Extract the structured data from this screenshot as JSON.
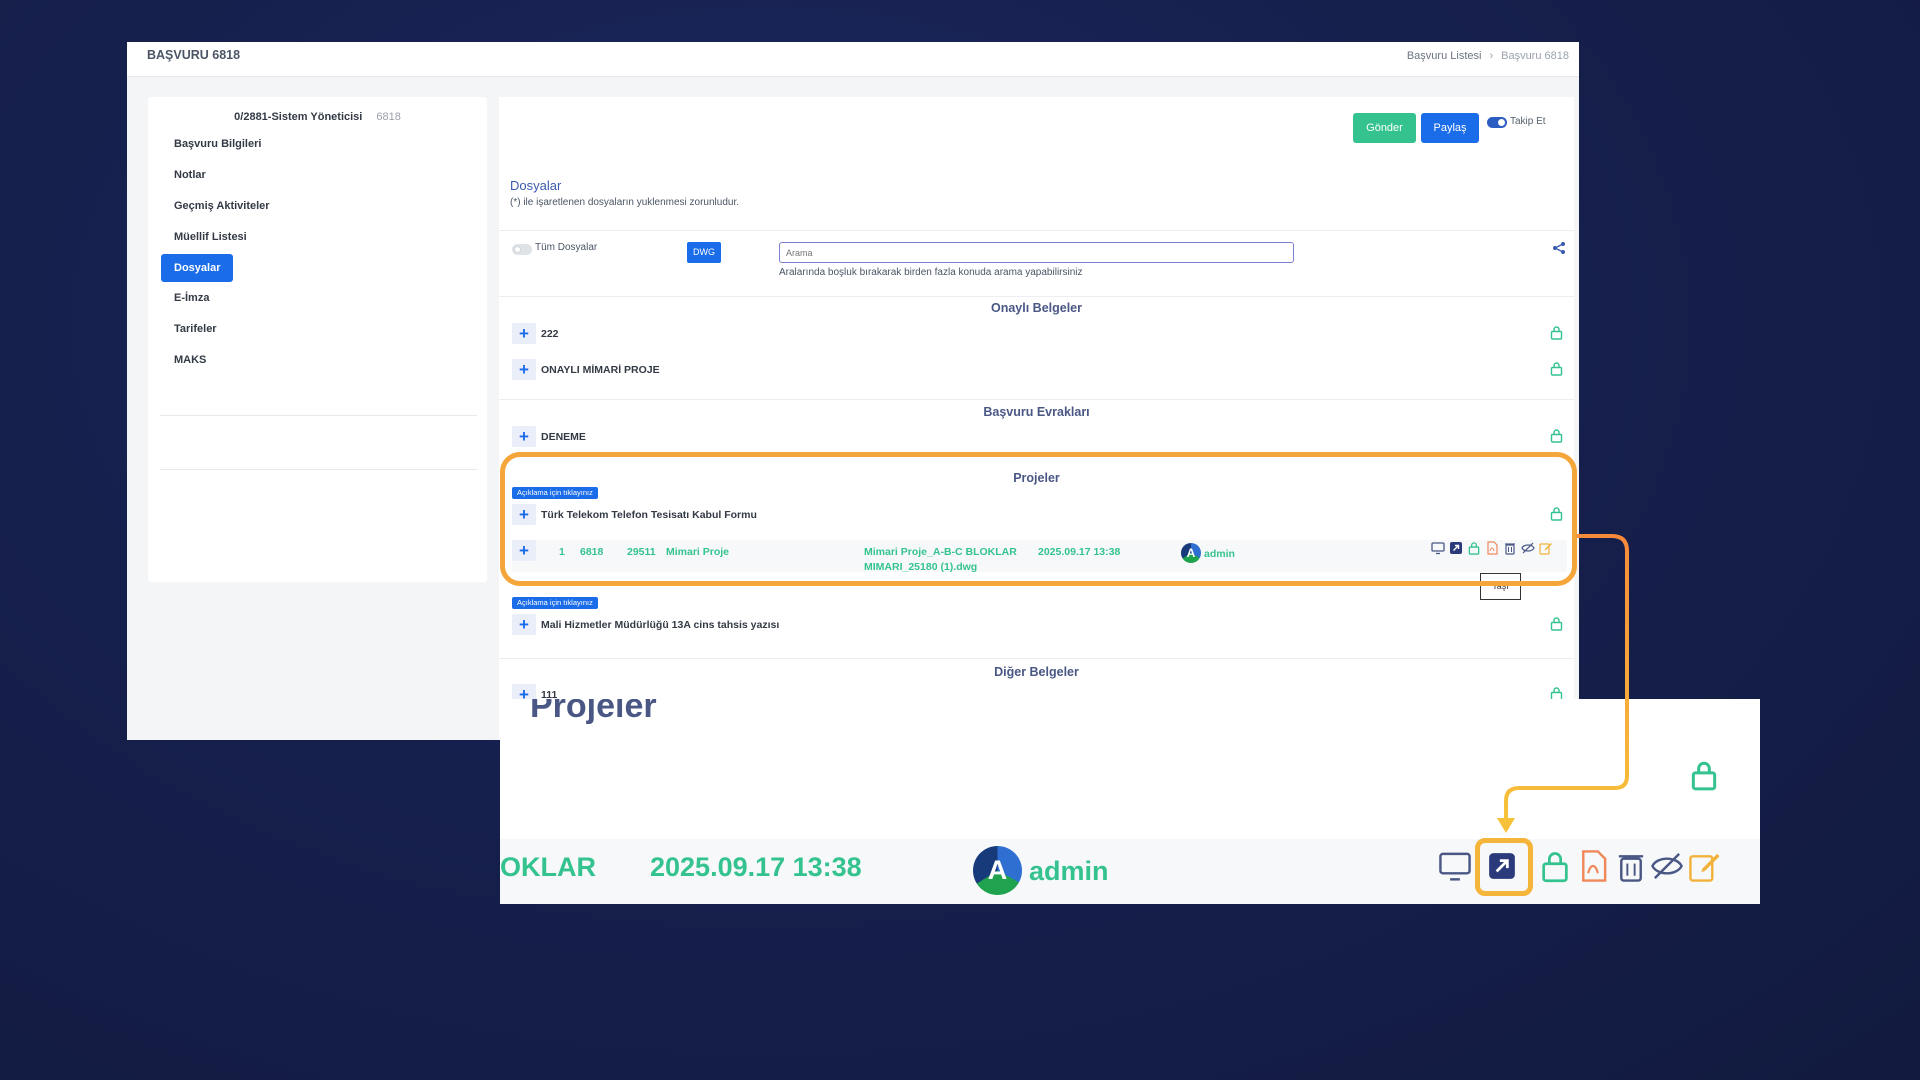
{
  "header": {
    "title": "BAŞVURU 6818",
    "breadcrumb": [
      "Başvuru Listesi",
      "Başvuru 6818"
    ]
  },
  "sidebar": {
    "user": "0/2881-Sistem Yöneticisi",
    "number": "6818",
    "items": [
      {
        "label": "Başvuru Bilgileri",
        "active": false
      },
      {
        "label": "Notlar",
        "active": false
      },
      {
        "label": "Geçmiş Aktiviteler",
        "active": false
      },
      {
        "label": "Müellif Listesi",
        "active": false
      },
      {
        "label": "Dosyalar",
        "active": true
      },
      {
        "label": "E-İmza",
        "active": false
      },
      {
        "label": "Tarifeler",
        "active": false
      },
      {
        "label": "MAKS",
        "active": false
      }
    ]
  },
  "actions": {
    "send": "Gönder",
    "share": "Paylaş",
    "follow": "Takip Et",
    "follow_on": true
  },
  "files": {
    "title": "Dosyalar",
    "note": "(*) ile işaretlenen dosyaların yuklenmesi zorunludur.",
    "all_files_label": "Tüm Dosyalar",
    "all_files_on": false,
    "dwg_label": "DWG",
    "search_placeholder": "Arama",
    "search_hint": "Aralarında boşluk bırakarak birden fazla konuda arama yapabilirsiniz"
  },
  "groups": [
    {
      "title": "Onaylı Belgeler",
      "rows": [
        "222",
        "ONAYLI MİMARİ PROJE"
      ]
    },
    {
      "title": "Başvuru Evrakları",
      "rows": [
        "DENEME"
      ]
    },
    {
      "title": "Projeler",
      "tag": "Açıklama için tıklayınız",
      "rows": [
        "Türk Telekom Telefon Tesisatı Kabul Formu"
      ]
    },
    {
      "tag": "Açıklama için tıklayınız",
      "rows": [
        "Mali Hizmetler Müdürlüğü 13A cins tahsis yazısı"
      ]
    },
    {
      "title": "Diğer Belgeler",
      "rows": [
        "111"
      ]
    }
  ],
  "file_row": {
    "index": "1",
    "app_no": "6818",
    "doc_no": "29511",
    "type": "Mimari Proje",
    "filename_line1": "Mimari Proje_A-B-C BLOKLAR",
    "filename_line2": "MIMARI_25180 (1).dwg",
    "date": "2025.09.17 13:38",
    "user": "admin",
    "avatar_letter": "A",
    "tooltip": "Taşı",
    "icons": [
      "monitor-icon",
      "move-icon",
      "lock-icon",
      "pdf-icon",
      "trash-icon",
      "eye-slash-icon",
      "edit-icon"
    ]
  },
  "zoom": {
    "ghost_title": "Projeler",
    "file_fragment": "OKLAR",
    "date": "2025.09.17 13:38",
    "user": "admin",
    "avatar_letter": "A"
  },
  "colors": {
    "accent": "#1a6ce8",
    "success": "#34c38f",
    "highlight": "#f5a63a"
  }
}
